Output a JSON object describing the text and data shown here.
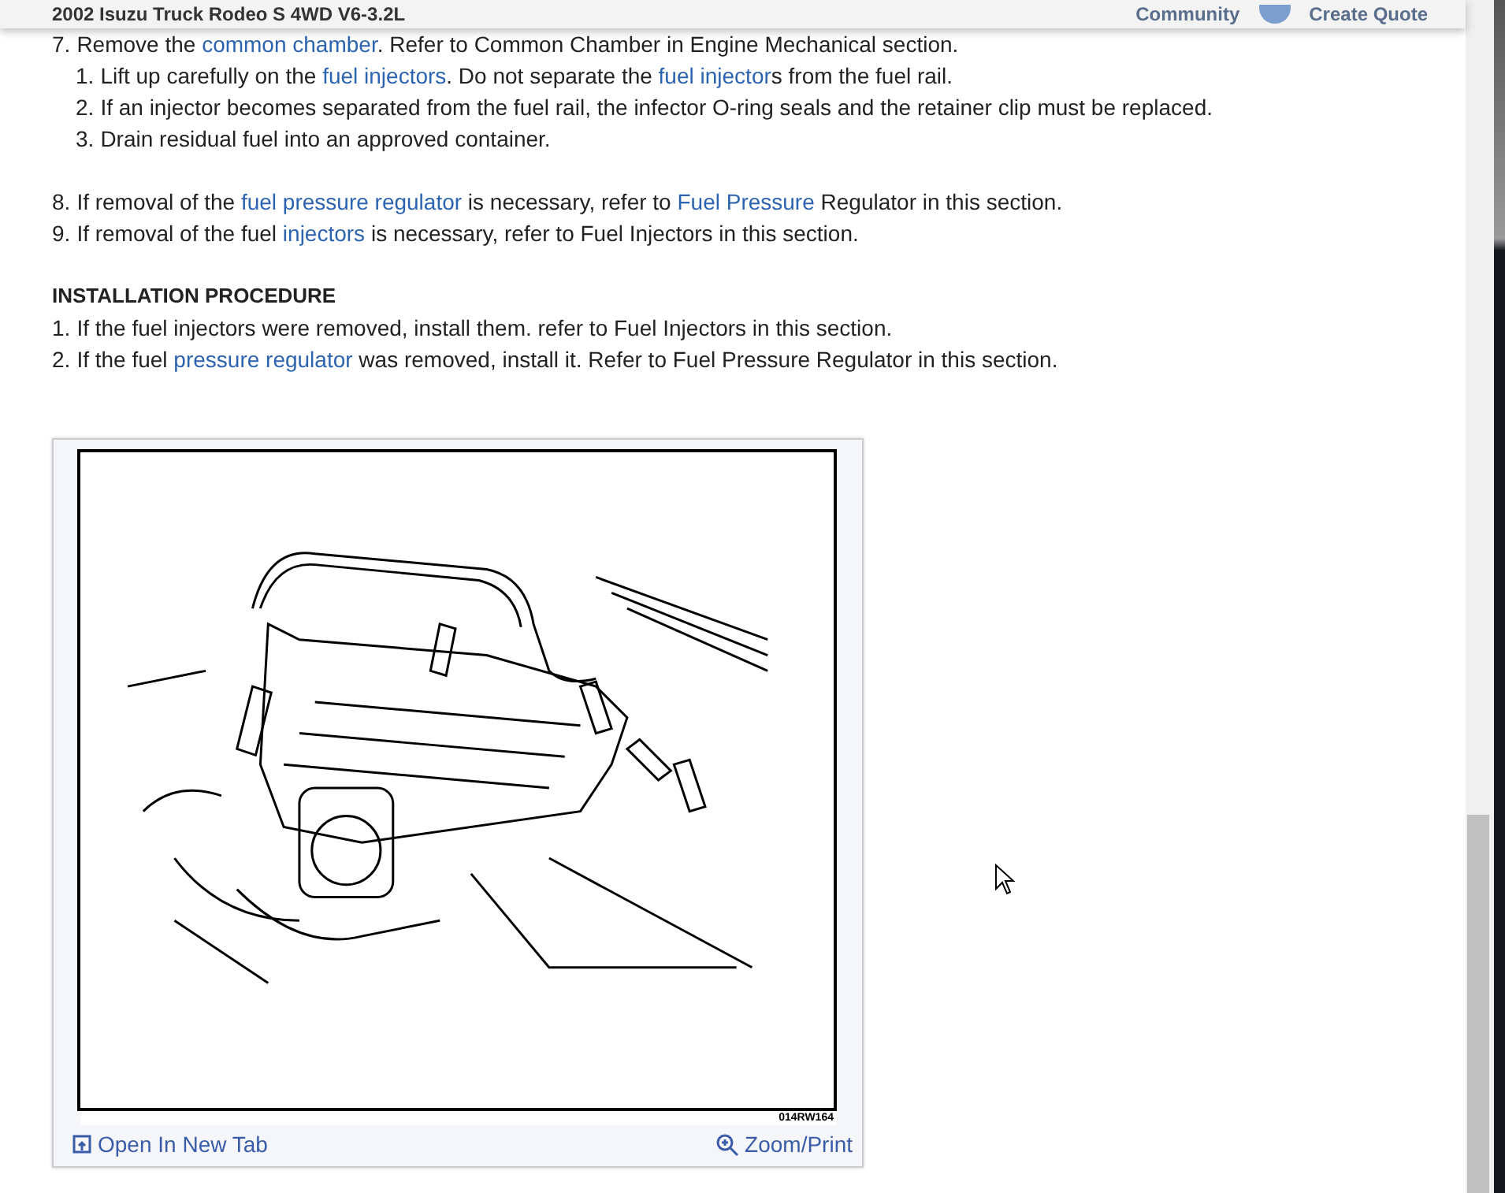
{
  "header": {
    "title": "2002 Isuzu Truck Rodeo S 4WD V6-3.2L",
    "community": "Community",
    "create_quote": "Create Quote"
  },
  "steps": [
    {
      "number": "7.",
      "segments": [
        {
          "text": "Remove the ",
          "link": false
        },
        {
          "text": "common chamber",
          "link": true
        },
        {
          "text": ". Refer to Common Chamber in Engine Mechanical section.",
          "link": false
        }
      ],
      "substeps": [
        {
          "number": "1.",
          "segments": [
            {
              "text": "Lift up carefully on the ",
              "link": false
            },
            {
              "text": "fuel injectors",
              "link": true
            },
            {
              "text": ". Do not separate the ",
              "link": false
            },
            {
              "text": "fuel injector",
              "link": true
            },
            {
              "text": "s from the fuel rail.",
              "link": false
            }
          ]
        },
        {
          "number": "2.",
          "segments": [
            {
              "text": "If an injector becomes separated from the fuel rail, the infector O-ring seals and the retainer clip must be replaced.",
              "link": false
            }
          ]
        },
        {
          "number": "3.",
          "segments": [
            {
              "text": "Drain residual fuel into an approved container.",
              "link": false
            }
          ]
        }
      ]
    },
    {
      "number": "8.",
      "segments": [
        {
          "text": "If removal of the ",
          "link": false
        },
        {
          "text": "fuel pressure regulator",
          "link": true
        },
        {
          "text": " is necessary, refer to ",
          "link": false
        },
        {
          "text": "Fuel Pressure",
          "link": true
        },
        {
          "text": " Regulator in this section.",
          "link": false
        }
      ]
    },
    {
      "number": "9.",
      "segments": [
        {
          "text": "If removal of the fuel ",
          "link": false
        },
        {
          "text": "injectors",
          "link": true
        },
        {
          "text": " is necessary, refer to Fuel Injectors in this section.",
          "link": false
        }
      ]
    }
  ],
  "section_heading": "INSTALLATION PROCEDURE",
  "install_steps": [
    {
      "number": "1.",
      "segments": [
        {
          "text": "If the fuel injectors were removed, install them. refer to Fuel Injectors in this section.",
          "link": false
        }
      ]
    },
    {
      "number": "2.",
      "segments": [
        {
          "text": "If the fuel ",
          "link": false
        },
        {
          "text": "pressure regulator",
          "link": true
        },
        {
          "text": " was removed, install it. Refer to Fuel Pressure Regulator in this section.",
          "link": false
        }
      ]
    }
  ],
  "figure": {
    "code": "014RW164",
    "open_link": "Open In New Tab",
    "zoom_link": "Zoom/Print"
  }
}
